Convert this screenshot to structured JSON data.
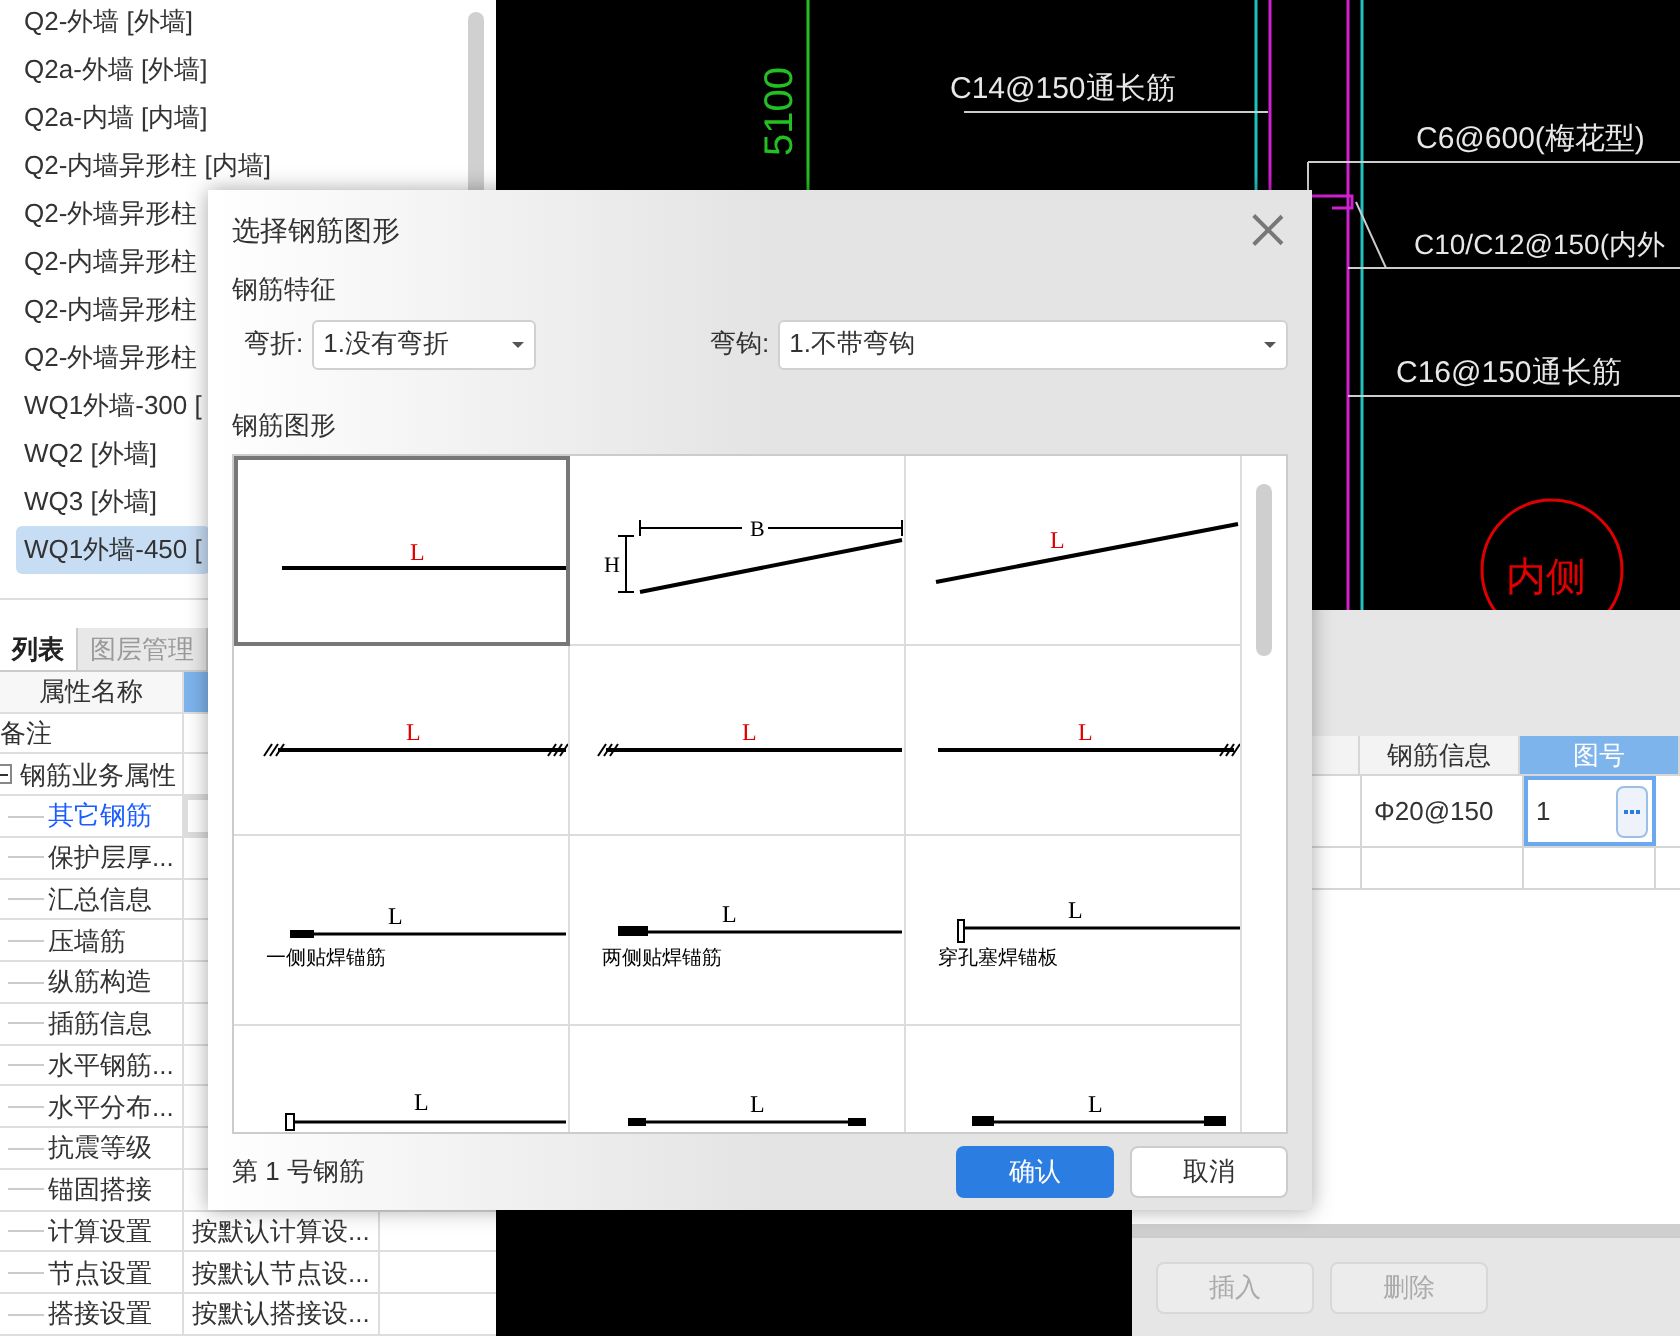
{
  "component_list": [
    {
      "label": "Q2-外墙 [外墙]",
      "selected": false
    },
    {
      "label": "Q2a-外墙 [外墙]",
      "selected": false
    },
    {
      "label": "Q2a-内墙 [内墙]",
      "selected": false
    },
    {
      "label": "Q2-内墙异形柱 [内墙]",
      "selected": false
    },
    {
      "label": "Q2-外墙异形柱",
      "selected": false
    },
    {
      "label": "Q2-内墙异形柱",
      "selected": false
    },
    {
      "label": "Q2-内墙异形柱",
      "selected": false
    },
    {
      "label": "Q2-外墙异形柱",
      "selected": false
    },
    {
      "label": "WQ1外墙-300 [",
      "selected": false
    },
    {
      "label": "WQ2 [外墙]",
      "selected": false
    },
    {
      "label": "WQ3 [外墙]",
      "selected": false
    },
    {
      "label": "WQ1外墙-450 [",
      "selected": true
    }
  ],
  "panel_tabs": [
    {
      "label": "列表",
      "selected": true
    },
    {
      "label": "图层管理",
      "selected": false
    }
  ],
  "properties": {
    "column": "属性名称",
    "rows": [
      {
        "name": "备注"
      },
      {
        "name": "钢筋业务属性",
        "expanded": true,
        "children": [
          {
            "name": "其它钢筋",
            "selected": true
          },
          {
            "name": "保护层厚...",
            "selected": false
          },
          {
            "name": "汇总信息",
            "selected": false
          },
          {
            "name": "压墙筋",
            "selected": false
          },
          {
            "name": "纵筋构造",
            "selected": false
          },
          {
            "name": "插筋信息",
            "selected": false
          },
          {
            "name": "水平钢筋...",
            "selected": false
          },
          {
            "name": "水平分布...",
            "selected": false
          },
          {
            "name": "抗震等级",
            "selected": false
          },
          {
            "name": "锚固搭接",
            "selected": false
          },
          {
            "name": "计算设置",
            "value": "按默认计算设...",
            "selected": false
          },
          {
            "name": "节点设置",
            "value": "按默认节点设...",
            "selected": false
          },
          {
            "name": "搭接设置",
            "value": "按默认搭接设...",
            "selected": false
          }
        ]
      }
    ]
  },
  "cad": {
    "dimension": "5100",
    "annotations": [
      "C14@150通长筋",
      "C6@600(梅花型)",
      "C10/C12@150(内外",
      "C16@150通长筋"
    ],
    "circle_label": "内侧"
  },
  "rebar_window": {
    "columns": [
      {
        "label": "钢筋信息",
        "selected": false
      },
      {
        "label": "图号",
        "selected": true
      }
    ],
    "rows": [
      {
        "cells": [
          "Φ20@150",
          "1"
        ]
      }
    ],
    "buttons": [
      {
        "label": "插入",
        "disabled": true
      },
      {
        "label": "删除",
        "disabled": true
      }
    ]
  },
  "dialog": {
    "title": "选择钢筋图形",
    "features_label": "钢筋特征",
    "fields": [
      {
        "label": "弯折:",
        "value": "1.没有弯折"
      },
      {
        "label": "弯钩:",
        "value": "1.不带弯钩"
      }
    ],
    "shapes_label": "钢筋图形",
    "shapes": [
      {
        "kind": "straight",
        "label": "L",
        "selected": true
      },
      {
        "kind": "slope_dims",
        "width_label": "B",
        "height_label": "H",
        "selected": false
      },
      {
        "kind": "slope",
        "label": "L",
        "selected": false
      },
      {
        "kind": "hatch_both",
        "label": "L",
        "selected": false
      },
      {
        "kind": "hatch_left",
        "label": "L",
        "selected": false
      },
      {
        "kind": "hatch_right",
        "label": "L",
        "selected": false
      },
      {
        "kind": "weld_one",
        "label": "L",
        "caption": "一侧贴焊锚筋",
        "selected": false
      },
      {
        "kind": "weld_two",
        "label": "L",
        "caption": "两侧贴焊锚筋",
        "selected": false
      },
      {
        "kind": "plate",
        "label": "L",
        "caption": "穿孔塞焊锚板",
        "selected": false
      },
      {
        "kind": "end_cap",
        "label": "L",
        "selected": false
      },
      {
        "kind": "pads_both",
        "label": "L",
        "selected": false
      },
      {
        "kind": "pads_both_big",
        "label": "L",
        "selected": false
      }
    ],
    "status": "第 1 号钢筋",
    "buttons": [
      {
        "label": "确认",
        "kind": "primary"
      },
      {
        "label": "取消",
        "kind": "secondary"
      }
    ]
  }
}
